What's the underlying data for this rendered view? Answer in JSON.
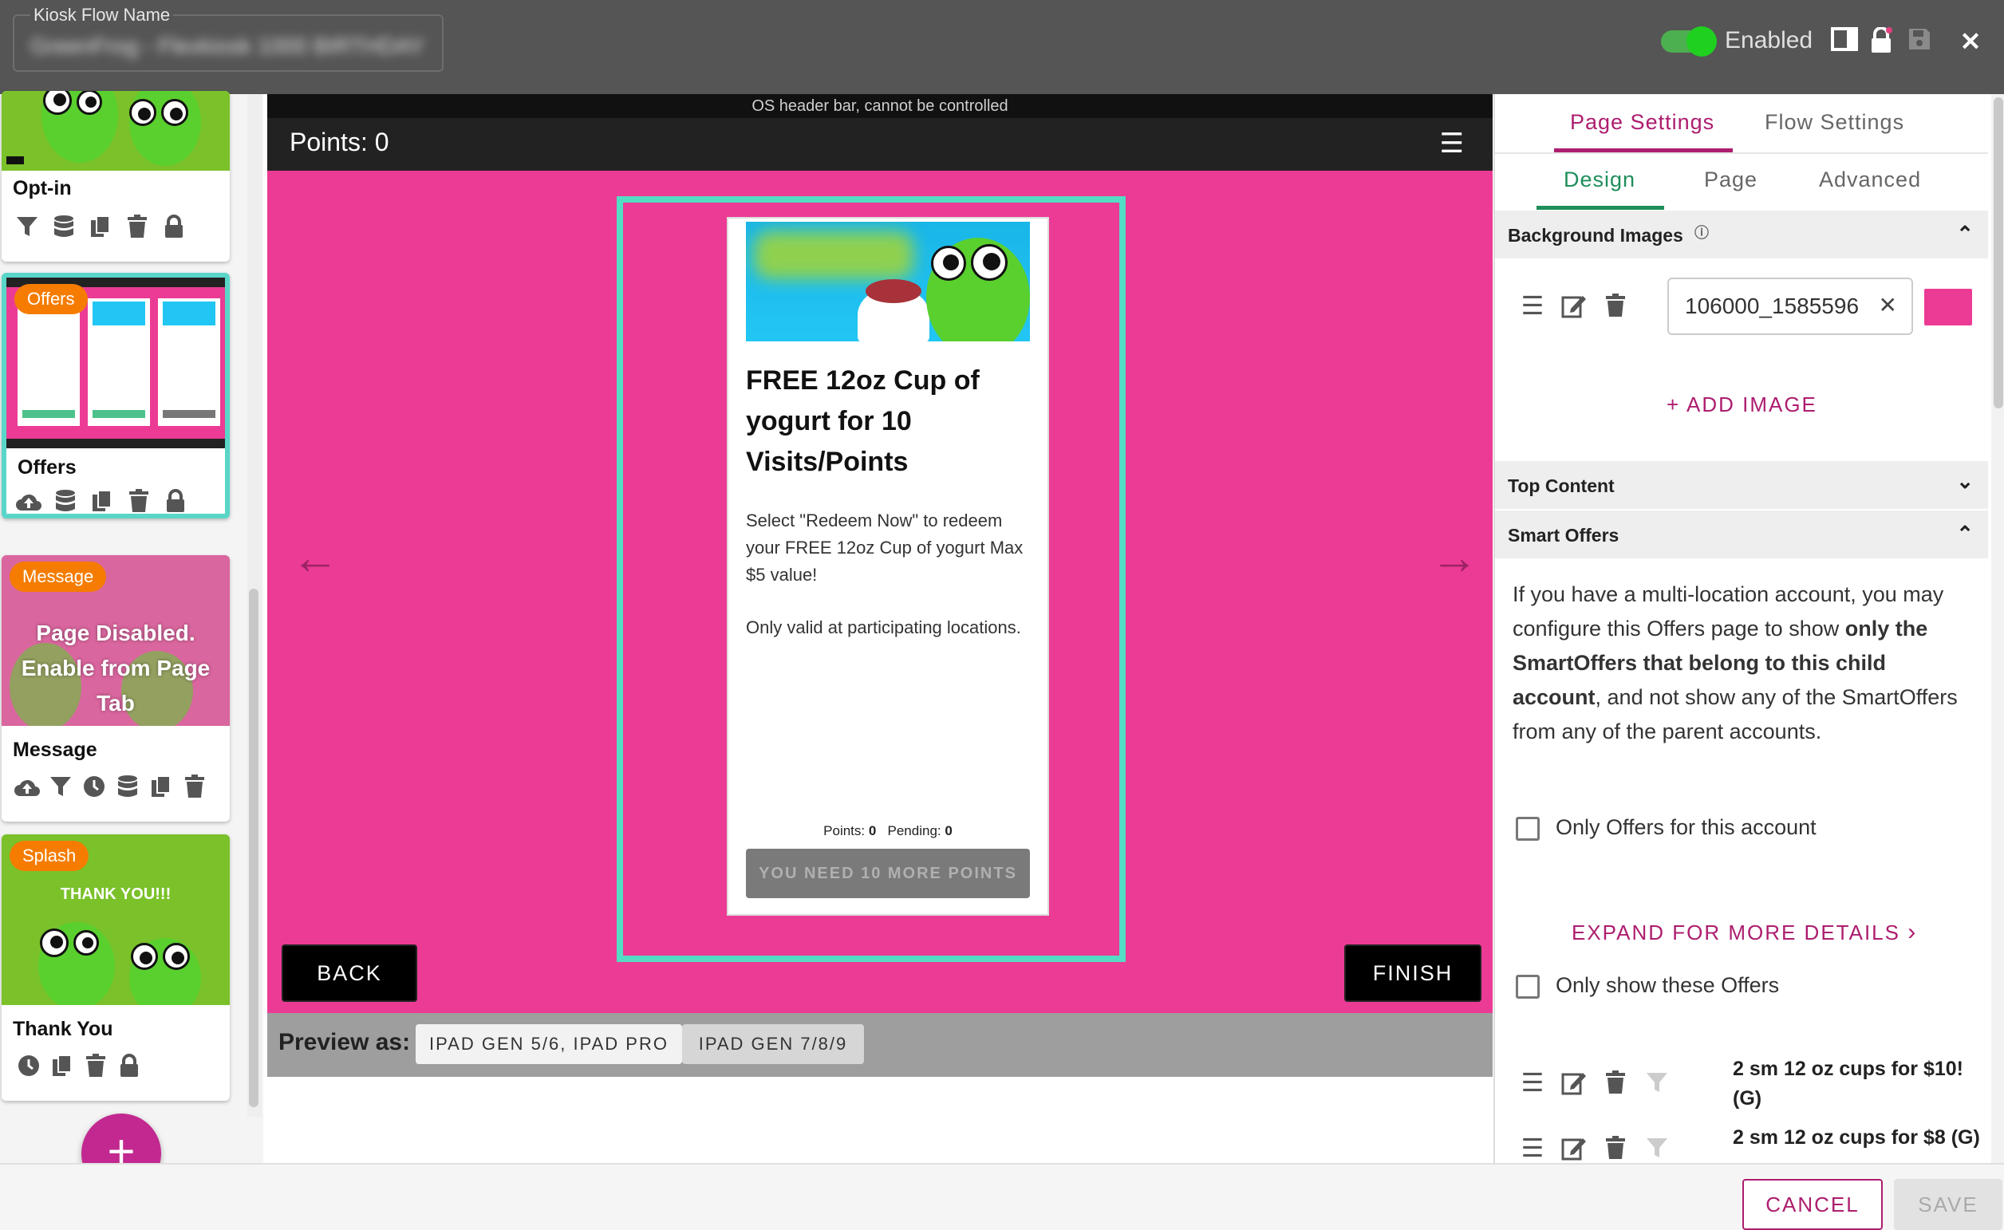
{
  "topbar": {
    "kiosk_label": "Kiosk Flow Name",
    "kiosk_value": "GreenFrog - Flexkiosk 1000 BIRTHDAY (S",
    "enabled_label": "Enabled",
    "icons": [
      "tablet-icon",
      "lock-icon",
      "save-icon",
      "close-icon"
    ]
  },
  "pages": [
    {
      "title": "Opt-in",
      "badge": "",
      "icons": [
        "filter-icon",
        "database-icon",
        "copy-icon",
        "trash-icon",
        "lock-icon"
      ]
    },
    {
      "title": "Offers",
      "badge": "Offers",
      "icons": [
        "upload-icon",
        "database-icon",
        "copy-icon",
        "trash-icon",
        "lock-icon"
      ]
    },
    {
      "title": "Message",
      "badge": "Message",
      "disabled_text": "Page Disabled. Enable from Page Tab",
      "icons": [
        "upload-icon",
        "filter-icon",
        "clock-icon",
        "database-icon",
        "copy-icon",
        "trash-icon"
      ]
    },
    {
      "title": "Thank You",
      "badge": "Splash",
      "thumb_text": "THANK YOU!!!",
      "icons": [
        "clock-icon",
        "copy-icon",
        "trash-icon",
        "lock-icon"
      ]
    }
  ],
  "preview": {
    "os_bar": "OS header bar, cannot be controlled",
    "points_label": "Points: 0",
    "offer_title": "FREE 12oz Cup of yogurt for 10 Visits/Points",
    "offer_desc": "Select \"Redeem Now\" to redeem your FREE 12oz Cup of yogurt Max $5 value!",
    "offer_desc2": "Only valid at participating locations.",
    "points_line_label": "Points:",
    "points_line_value": "0",
    "pending_label": "Pending:",
    "pending_value": "0",
    "offer_button": "YOU NEED 10 MORE POINTS",
    "back": "BACK",
    "finish": "FINISH",
    "preview_as": "Preview as:",
    "devices": [
      "IPAD GEN 5/6, IPAD PRO",
      "IPAD GEN 7/8/9"
    ],
    "selected_device": "IPAD GEN 7/8/9"
  },
  "settings": {
    "main_tabs": [
      "Page Settings",
      "Flow Settings"
    ],
    "active_main_tab": "Page Settings",
    "sub_tabs": [
      "Design",
      "Page",
      "Advanced"
    ],
    "active_sub_tab": "Design",
    "background_images_title": "Background Images",
    "image_value": "106000_1585596",
    "image_color": "#ec3b94",
    "add_image": "+ ADD IMAGE",
    "top_content_title": "Top Content",
    "smart_offers_title": "Smart Offers",
    "smart_text_1": "If you have a multi-location account, you may configure this Offers page to show ",
    "smart_text_bold_1": "only the SmartOffers that belong to this child account",
    "smart_text_2": ", and not show any of the SmartOffers from any of the parent accounts.",
    "only_offers_label": "Only Offers for this account",
    "expand_label": "EXPAND FOR MORE DETAILS",
    "only_show_label": "Only show these Offers",
    "offer_items": [
      "2 sm 12 oz cups for $10! (G)",
      "2 sm 12 oz cups for $8 (G)"
    ]
  },
  "footer": {
    "cancel": "CANCEL",
    "save": "SAVE"
  },
  "colors": {
    "accent": "#ad1d6f",
    "stage": "#ec3b94",
    "frame": "#55dcc4",
    "badge": "#f57c00"
  }
}
